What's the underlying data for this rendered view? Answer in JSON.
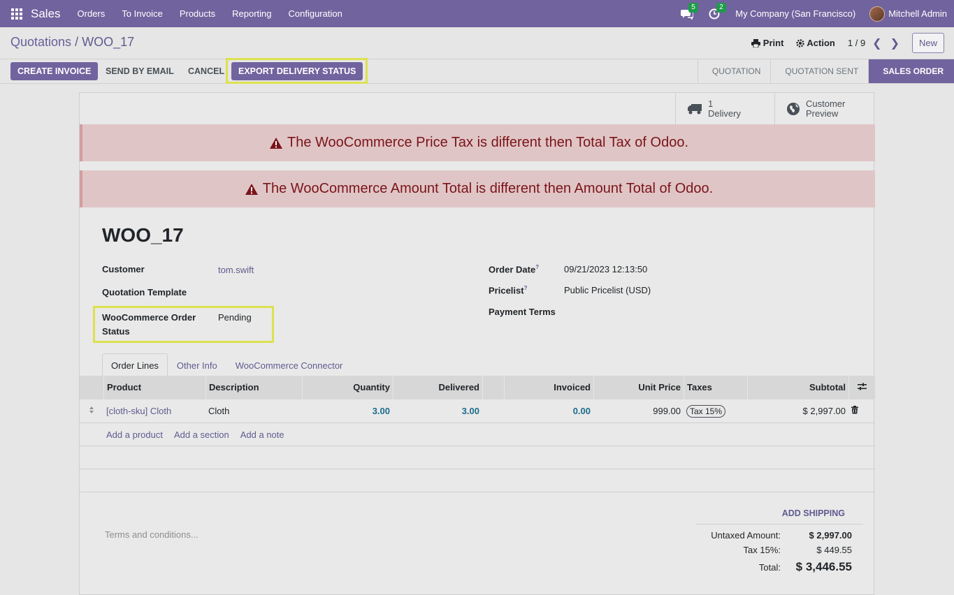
{
  "navbar": {
    "brand": "Sales",
    "menu": [
      "Orders",
      "To Invoice",
      "Products",
      "Reporting",
      "Configuration"
    ],
    "messages_count": "5",
    "activities_count": "2",
    "company": "My Company (San Francisco)",
    "user": "Mitchell Admin"
  },
  "control_panel": {
    "breadcrumb_parent": "Quotations",
    "breadcrumb_sep": " / ",
    "breadcrumb_current": "WOO_17",
    "print_label": "Print",
    "action_label": "Action",
    "pager": "1 / 9",
    "new_label": "New"
  },
  "header_buttons": {
    "create_invoice": "Create Invoice",
    "send_email": "Send by Email",
    "cancel": "Cancel",
    "export_delivery": "Export Delivery Status"
  },
  "stages": [
    "Quotation",
    "Quotation Sent",
    "Sales Order"
  ],
  "smart_buttons": {
    "delivery_count": "1",
    "delivery_label": "Delivery",
    "preview_line1": "Customer",
    "preview_line2": "Preview"
  },
  "alerts": [
    "The WooCommerce Price Tax is different then Total Tax of Odoo.",
    "The WooCommerce Amount Total is different then Amount Total of Odoo."
  ],
  "form": {
    "title": "WOO_17",
    "customer_label": "Customer",
    "customer_value": "tom.swift",
    "template_label": "Quotation Template",
    "woo_status_label_1": "WooCommerce Order",
    "woo_status_label_2": "Status",
    "woo_status_value": "Pending",
    "order_date_label": "Order Date",
    "order_date_value": "09/21/2023 12:13:50",
    "pricelist_label": "Pricelist",
    "pricelist_value": "Public Pricelist (USD)",
    "payment_terms_label": "Payment Terms",
    "help_mark": "?"
  },
  "tabs": [
    "Order Lines",
    "Other Info",
    "WooCommerce Connector"
  ],
  "table": {
    "headers": [
      "Product",
      "Description",
      "Quantity",
      "Delivered",
      "Invoiced",
      "Unit Price",
      "Taxes",
      "Subtotal"
    ],
    "rows": [
      {
        "product": "[cloth-sku] Cloth",
        "description": "Cloth",
        "quantity": "3.00",
        "delivered": "3.00",
        "invoiced": "0.00",
        "unit_price": "999.00",
        "taxes": "Tax 15%",
        "subtotal": "$ 2,997.00"
      }
    ],
    "add_product": "Add a product",
    "add_section": "Add a section",
    "add_note": "Add a note"
  },
  "footer": {
    "terms_placeholder": "Terms and conditions...",
    "add_shipping": "Add Shipping",
    "untaxed_label": "Untaxed Amount:",
    "untaxed_value": "$ 2,997.00",
    "tax_label": "Tax 15%:",
    "tax_value": "$ 449.55",
    "total_label": "Total:",
    "total_value": "$ 3,446.55"
  },
  "colors": {
    "brand": "#71639e",
    "alert_bg": "#e0c5c6",
    "alert_text": "#7a1419",
    "highlight": "#dde14f"
  }
}
